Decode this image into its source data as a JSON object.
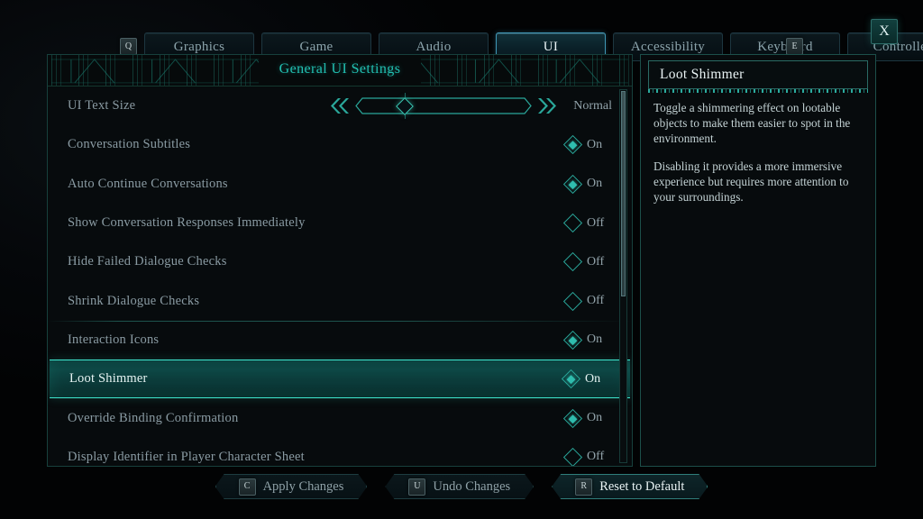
{
  "tabbar": {
    "left_key": "Q",
    "right_key": "E",
    "close_label": "X",
    "tabs": [
      {
        "label": "Graphics",
        "selected": false
      },
      {
        "label": "Game",
        "selected": false
      },
      {
        "label": "Audio",
        "selected": false
      },
      {
        "label": "UI",
        "selected": true
      },
      {
        "label": "Accessibility",
        "selected": false
      },
      {
        "label": "Keyboard",
        "selected": false
      },
      {
        "label": "Controller",
        "selected": false
      }
    ]
  },
  "panel": {
    "title": "General UI Settings",
    "settings": [
      {
        "label": "UI Text Size",
        "type": "slider",
        "value": "Normal",
        "position_pct": 28,
        "selected": false,
        "divider_above": false
      },
      {
        "label": "Conversation Subtitles",
        "type": "toggle",
        "value": "On",
        "selected": false,
        "divider_above": false
      },
      {
        "label": "Auto Continue Conversations",
        "type": "toggle",
        "value": "On",
        "selected": false,
        "divider_above": false
      },
      {
        "label": "Show Conversation Responses Immediately",
        "type": "toggle",
        "value": "Off",
        "selected": false,
        "divider_above": false
      },
      {
        "label": "Hide Failed Dialogue Checks",
        "type": "toggle",
        "value": "Off",
        "selected": false,
        "divider_above": false
      },
      {
        "label": "Shrink Dialogue Checks",
        "type": "toggle",
        "value": "Off",
        "selected": false,
        "divider_above": false
      },
      {
        "label": "Interaction Icons",
        "type": "toggle",
        "value": "On",
        "selected": false,
        "divider_above": true
      },
      {
        "label": "Loot Shimmer",
        "type": "toggle",
        "value": "On",
        "selected": true,
        "divider_above": false
      },
      {
        "label": "Override Binding Confirmation",
        "type": "toggle",
        "value": "On",
        "selected": false,
        "divider_above": false
      },
      {
        "label": "Display Identifier in Player Character Sheet",
        "type": "toggle",
        "value": "Off",
        "selected": false,
        "divider_above": false
      }
    ]
  },
  "info": {
    "title": "Loot Shimmer",
    "paragraphs": [
      "Toggle a shimmering effect on lootable objects to make them easier to spot in the environment.",
      "Disabling it provides a more immersive experience but requires more attention to your surroundings."
    ]
  },
  "actions": [
    {
      "key": "C",
      "label": "Apply Changes",
      "focused": false
    },
    {
      "key": "U",
      "label": "Undo Changes",
      "focused": false
    },
    {
      "key": "R",
      "label": "Reset to Default",
      "focused": true
    }
  ],
  "colors": {
    "accent_teal": "#22c0b2",
    "selected_row_edge": "#3fe8d0",
    "tab_selected_border": "#3f97b5",
    "label_text": "#8a9ba3",
    "panel_bg": "#070b0d"
  }
}
